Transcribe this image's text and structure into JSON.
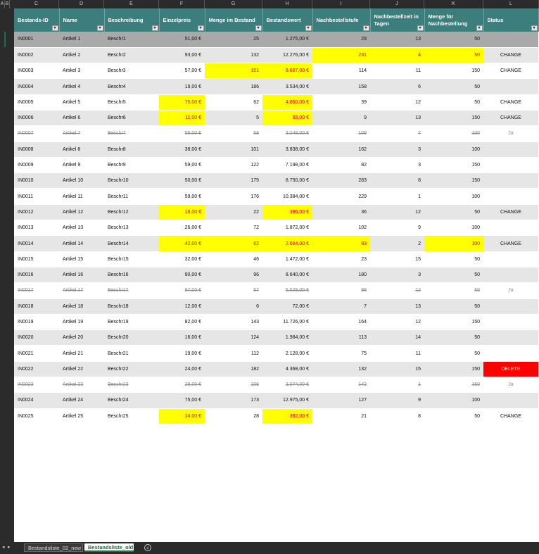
{
  "column_letters": [
    "A",
    "B",
    "C",
    "D",
    "E",
    "F",
    "G",
    "H",
    "I",
    "J",
    "K",
    "L"
  ],
  "headers": [
    "Bestands-ID",
    "Name",
    "Beschreibung",
    "Einzelpreis",
    "Menge im Bestand",
    "Bestandswert",
    "Nachbestellstufe",
    "Nachbestellzeit in Tagen",
    "Menge für Nachbestellung",
    "Status"
  ],
  "filter_glyph": "▾",
  "rows": [
    {
      "cells": [
        "IN0001",
        "Artikel 1",
        "Beschr1",
        "51,00 €",
        "25",
        "1.275,00 €",
        "29",
        "13",
        "50",
        ""
      ],
      "hl": [],
      "strike": false
    },
    {
      "cells": [
        "IN0002",
        "Artikel 2",
        "Beschr2",
        "93,00 €",
        "132",
        "12.276,00 €",
        "231",
        "4",
        "50",
        "CHANGE"
      ],
      "hl": [
        6,
        7,
        8
      ],
      "strike": false
    },
    {
      "cells": [
        "IN0003",
        "Artikel 3",
        "Beschr3",
        "57,00 €",
        "151",
        "8.607,00 €",
        "114",
        "11",
        "150",
        "CHANGE"
      ],
      "hl": [
        4,
        5
      ],
      "strike": false
    },
    {
      "cells": [
        "IN0004",
        "Artikel 4",
        "Beschr4",
        "19,00 €",
        "186",
        "3.534,00 €",
        "158",
        "6",
        "50",
        ""
      ],
      "hl": [],
      "strike": false
    },
    {
      "cells": [
        "IN0005",
        "Artikel 5",
        "Beschr5",
        "75,00 €",
        "62",
        "4.650,00 €",
        "39",
        "12",
        "50",
        "CHANGE"
      ],
      "hl": [
        3,
        5
      ],
      "strike": false
    },
    {
      "cells": [
        "IN0006",
        "Artikel 6",
        "Beschr6",
        "11,00 €",
        "5",
        "55,00 €",
        "9",
        "13",
        "150",
        "CHANGE"
      ],
      "hl": [
        3,
        5
      ],
      "strike": false
    },
    {
      "cells": [
        "IN0007",
        "Artikel 7",
        "Beschr7",
        "56,00 €",
        "58",
        "3.248,00 €",
        "109",
        "7",
        "100",
        "Ja"
      ],
      "hl": [],
      "strike": true
    },
    {
      "cells": [
        "IN0008",
        "Artikel 8",
        "Beschr8",
        "38,00 €",
        "101",
        "3.838,00 €",
        "162",
        "3",
        "100",
        ""
      ],
      "hl": [],
      "strike": false
    },
    {
      "cells": [
        "IN0009",
        "Artikel 9",
        "Beschr9",
        "59,00 €",
        "122",
        "7.198,00 €",
        "82",
        "3",
        "150",
        ""
      ],
      "hl": [],
      "strike": false
    },
    {
      "cells": [
        "IN0010",
        "Artikel 10",
        "Beschr10",
        "50,00 €",
        "175",
        "8.750,00 €",
        "283",
        "8",
        "150",
        ""
      ],
      "hl": [],
      "strike": false
    },
    {
      "cells": [
        "IN0011",
        "Artikel 11",
        "Beschr11",
        "59,00 €",
        "176",
        "10.384,00 €",
        "229",
        "1",
        "100",
        ""
      ],
      "hl": [],
      "strike": false
    },
    {
      "cells": [
        "IN0012",
        "Artikel 12",
        "Beschr12",
        "18,00 €",
        "22",
        "396,00 €",
        "36",
        "12",
        "50",
        "CHANGE"
      ],
      "hl": [
        3,
        5
      ],
      "strike": false
    },
    {
      "cells": [
        "IN0013",
        "Artikel 13",
        "Beschr13",
        "26,00 €",
        "72",
        "1.872,00 €",
        "102",
        "9",
        "100",
        ""
      ],
      "hl": [],
      "strike": false
    },
    {
      "cells": [
        "IN0014",
        "Artikel 14",
        "Beschr14",
        "42,00 €",
        "62",
        "2.604,00 €",
        "83",
        "2",
        "100",
        "CHANGE"
      ],
      "hl": [
        3,
        4,
        5,
        6,
        8
      ],
      "strike": false
    },
    {
      "cells": [
        "IN0015",
        "Artikel 15",
        "Beschr15",
        "32,00 €",
        "46",
        "1.472,00 €",
        "23",
        "15",
        "50",
        ""
      ],
      "hl": [],
      "strike": false
    },
    {
      "cells": [
        "IN0016",
        "Artikel 16",
        "Beschr16",
        "90,00 €",
        "96",
        "8.640,00 €",
        "180",
        "3",
        "50",
        ""
      ],
      "hl": [],
      "strike": false
    },
    {
      "cells": [
        "IN0017",
        "Artikel 17",
        "Beschr17",
        "97,00 €",
        "57",
        "5.529,00 €",
        "98",
        "12",
        "50",
        "Ja"
      ],
      "hl": [],
      "strike": true
    },
    {
      "cells": [
        "IN0018",
        "Artikel 18",
        "Beschr18",
        "12,00 €",
        "6",
        "72,00 €",
        "7",
        "13",
        "50",
        ""
      ],
      "hl": [],
      "strike": false
    },
    {
      "cells": [
        "IN0019",
        "Artikel 19",
        "Beschr19",
        "82,00 €",
        "143",
        "11.726,00 €",
        "164",
        "12",
        "150",
        ""
      ],
      "hl": [],
      "strike": false
    },
    {
      "cells": [
        "IN0020",
        "Artikel 20",
        "Beschr20",
        "16,00 €",
        "124",
        "1.984,00 €",
        "113",
        "14",
        "50",
        ""
      ],
      "hl": [],
      "strike": false
    },
    {
      "cells": [
        "IN0021",
        "Artikel 21",
        "Beschr21",
        "19,00 €",
        "112",
        "2.128,00 €",
        "75",
        "11",
        "50",
        ""
      ],
      "hl": [],
      "strike": false
    },
    {
      "cells": [
        "IN0022",
        "Artikel 22",
        "Beschr22",
        "24,00 €",
        "182",
        "4.368,00 €",
        "132",
        "15",
        "150",
        "DELETE"
      ],
      "hl": [],
      "del": true,
      "strike": false
    },
    {
      "cells": [
        "IN0023",
        "Artikel 23",
        "Beschr23",
        "29,00 €",
        "106",
        "3.074,00 €",
        "142",
        "1",
        "150",
        "Ja"
      ],
      "hl": [],
      "strike": true
    },
    {
      "cells": [
        "IN0024",
        "Artikel 24",
        "Beschr24",
        "75,00 €",
        "173",
        "12.975,00 €",
        "127",
        "9",
        "100",
        ""
      ],
      "hl": [],
      "strike": false
    },
    {
      "cells": [
        "IN0025",
        "Artikel 25",
        "Beschr25",
        "14,00 €",
        "28",
        "392,00 €",
        "21",
        "8",
        "50",
        "CHANGE"
      ],
      "hl": [
        3,
        5
      ],
      "strike": false
    }
  ],
  "tabs": [
    {
      "label": "Bestandsliste_02_new",
      "active": false
    },
    {
      "label": "Bestandsliste_old",
      "active": true
    }
  ],
  "tab_nav": {
    "prev": "◂",
    "next": "▸",
    "add": "+"
  },
  "colors": {
    "header_bg": "#3c7e7c",
    "highlight": "#ffff00",
    "highlight_text": "#e00000",
    "delete_bg": "#ff0000"
  }
}
